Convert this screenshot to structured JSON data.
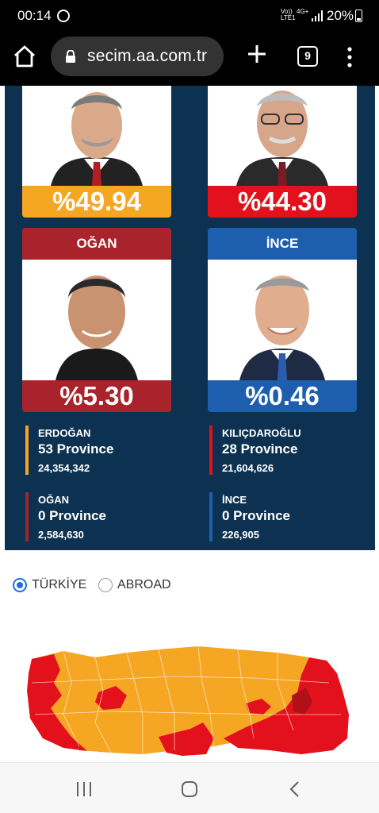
{
  "status_bar": {
    "time": "00:14",
    "volte": "Vo)) LTE1",
    "network": "4G+",
    "battery": "20%"
  },
  "browser": {
    "url": "secim.aa.com.tr",
    "tab_count": "9"
  },
  "candidates": [
    {
      "name": "",
      "percent": "%49.94",
      "color": "#f5a623"
    },
    {
      "name": "",
      "percent": "%44.30",
      "color": "#e3111b"
    },
    {
      "name": "OĞAN",
      "percent": "%5.30",
      "color": "#a8232b"
    },
    {
      "name": "İNCE",
      "percent": "%0.46",
      "color": "#1d5fae"
    }
  ],
  "province_stats": [
    {
      "name": "ERDOĞAN",
      "provinces": "53 Province",
      "votes": "24,354,342",
      "color": "#f5a623"
    },
    {
      "name": "KILIÇDAROĞLU",
      "provinces": "28 Province",
      "votes": "21,604,626",
      "color": "#e3111b"
    },
    {
      "name": "OĞAN",
      "provinces": "0 Province",
      "votes": "2,584,630",
      "color": "#a8232b"
    },
    {
      "name": "İNCE",
      "provinces": "0 Province",
      "votes": "226,905",
      "color": "#1d5fae"
    }
  ],
  "region_toggle": {
    "options": [
      "TÜRKİYE",
      "ABROAD"
    ],
    "selected": "TÜRKİYE"
  },
  "map_colors": {
    "orange": "#f5a623",
    "red": "#e3111b",
    "dark_red": "#b01018"
  }
}
